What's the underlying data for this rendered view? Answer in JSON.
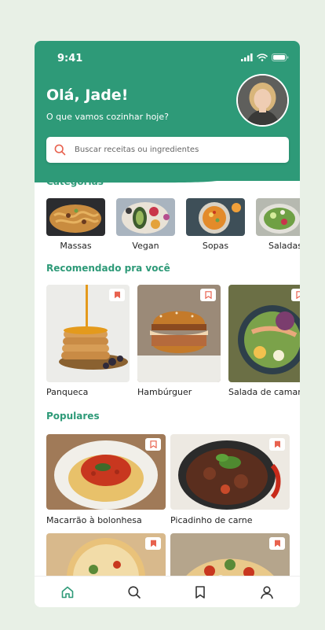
{
  "status": {
    "time": "9:41"
  },
  "header": {
    "greeting": "Olá, Jade!",
    "subtitle": "O que vamos cozinhar hoje?"
  },
  "search": {
    "placeholder": "Buscar receitas ou ingredientes"
  },
  "categories": {
    "title": "Categorias",
    "items": [
      {
        "label": "Massas"
      },
      {
        "label": "Vegan"
      },
      {
        "label": "Sopas"
      },
      {
        "label": "Saladas"
      }
    ]
  },
  "recommended": {
    "title": "Recomendado pra você",
    "items": [
      {
        "label": "Panqueca",
        "bookmarked": false
      },
      {
        "label": "Hambúrguer",
        "bookmarked": false
      },
      {
        "label": "Salada de camarão",
        "bookmarked": false
      }
    ]
  },
  "popular": {
    "title": "Populares",
    "items": [
      {
        "label": "Macarrão à bolonhesa",
        "bookmarked": false
      },
      {
        "label": "Picadinho de carne",
        "bookmarked": true
      },
      {
        "label": "",
        "bookmarked": true
      },
      {
        "label": "",
        "bookmarked": true
      }
    ]
  },
  "nav": {
    "active": "home",
    "items": [
      "home-icon",
      "search-icon",
      "bookmark-icon",
      "profile-icon"
    ]
  },
  "colors": {
    "brand": "#2e9a78",
    "accent": "#e8624f",
    "background": "#e8f0e6"
  }
}
